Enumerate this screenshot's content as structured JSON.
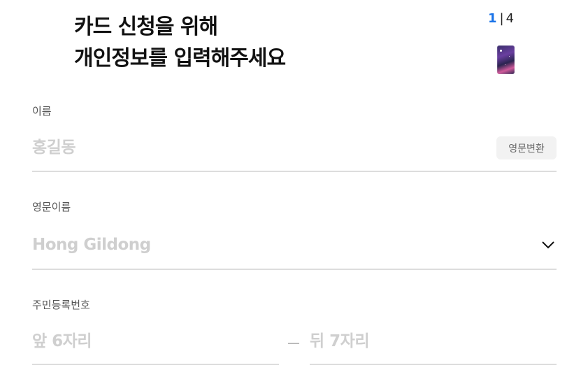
{
  "header": {
    "title_line1": "카드 신청을 위해",
    "title_line2": "개인정보를 입력해주세요",
    "step_current": "1",
    "step_separator": "|",
    "step_total": "4",
    "card_image": "card-thumbnail"
  },
  "fields": {
    "name": {
      "label": "이름",
      "placeholder": "홍길동",
      "convert_button": "영문변환"
    },
    "english_name": {
      "label": "영문이름",
      "placeholder": "Hong Gildong",
      "icon": "chevron-down-icon"
    },
    "resident_number": {
      "label": "주민등록번호",
      "front_placeholder": "앞 6자리",
      "back_placeholder": "뒤 7자리"
    }
  },
  "colors": {
    "accent": "#1a73e8",
    "placeholder": "#cfcfcf",
    "divider": "#dddddd"
  }
}
